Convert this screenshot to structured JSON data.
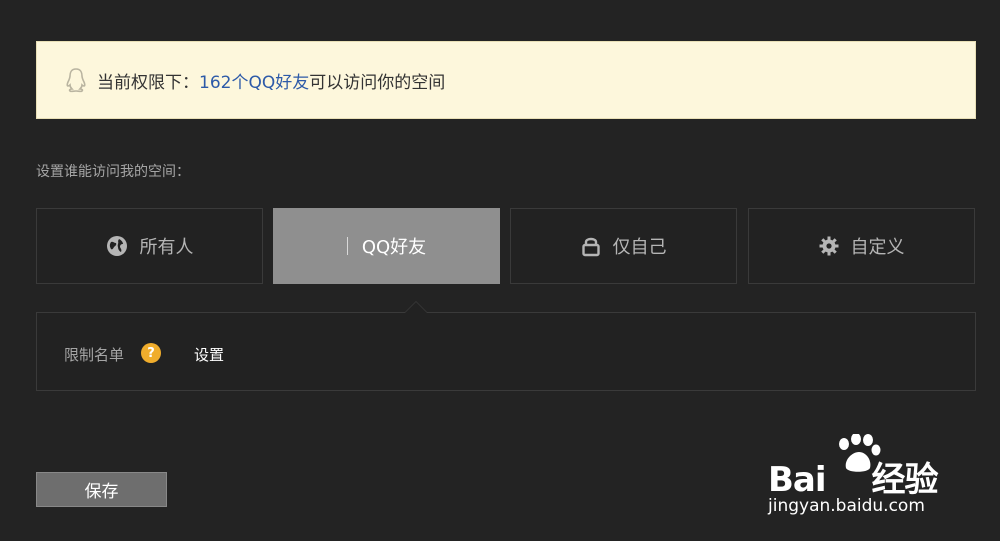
{
  "notice": {
    "prefix": "当前权限下：",
    "highlight": "162个QQ好友",
    "suffix": "可以访问你的空间",
    "colors": {
      "background": "#fdf7dc",
      "highlight": "#2d5aa8"
    }
  },
  "section_label": "设置谁能访问我的空间：",
  "tabs": [
    {
      "label": "所有人",
      "icon": "globe-icon",
      "active": false
    },
    {
      "label": "QQ好友",
      "icon": "none",
      "active": true
    },
    {
      "label": "仅自己",
      "icon": "lock-icon",
      "active": false
    },
    {
      "label": "自定义",
      "icon": "gear-icon",
      "active": false
    }
  ],
  "panel": {
    "limit_label": "限制名单",
    "help_glyph": "?",
    "set_link": "设置"
  },
  "save_button": "保存",
  "watermark": {
    "logo_prefix": "Bai",
    "logo_suffix": "经验",
    "url": "jingyan.baidu.com"
  }
}
